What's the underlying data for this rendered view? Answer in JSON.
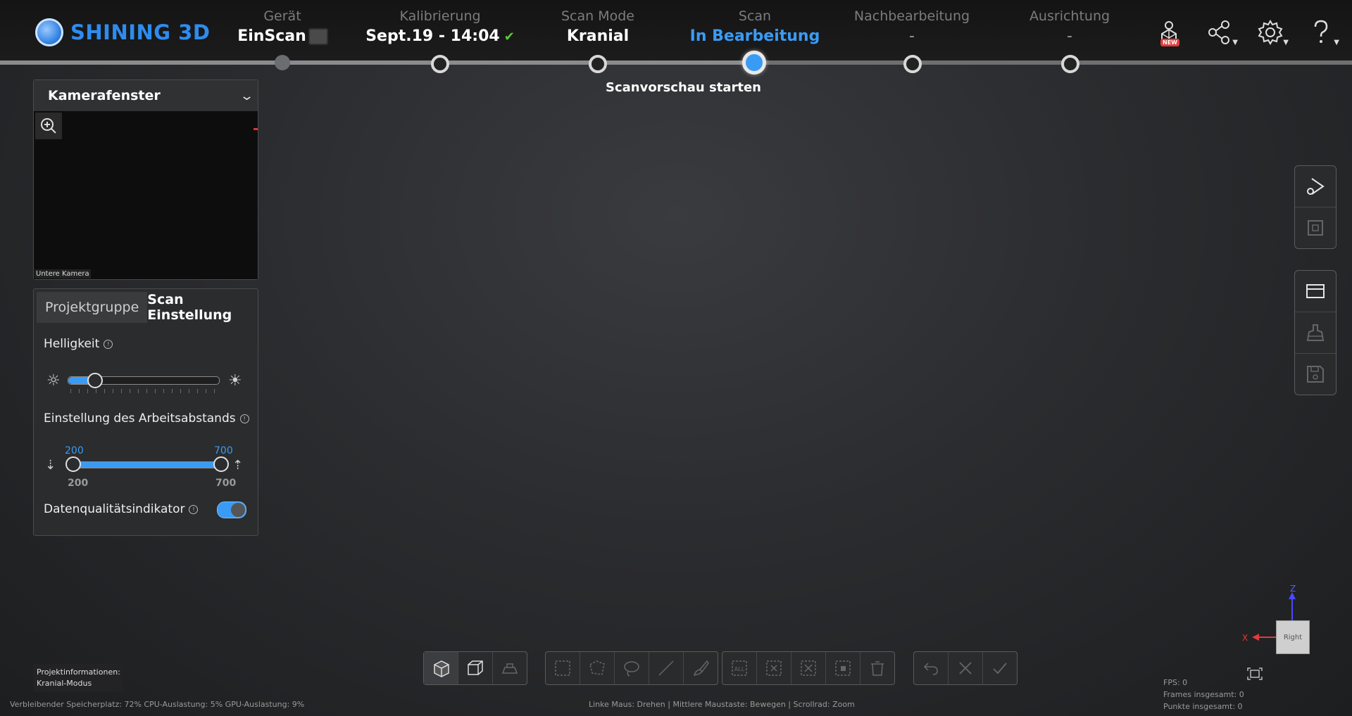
{
  "brand": {
    "name": "SHINING 3D"
  },
  "steps": [
    {
      "label": "Gerät",
      "value": "EinScan"
    },
    {
      "label": "Kalibrierung",
      "value": "Sept.19 - 14:04"
    },
    {
      "label": "Scan Mode",
      "value": "Kranial"
    },
    {
      "label": "Scan",
      "value": "In Bearbeitung"
    },
    {
      "label": "Nachbearbeitung",
      "value": "-"
    },
    {
      "label": "Ausrichtung",
      "value": "-"
    }
  ],
  "step_hint": "Scanvorschau starten",
  "top_icons": {
    "new_badge": "NEW",
    "icons": [
      "model-new-icon",
      "share-icon",
      "gear-icon",
      "help-icon"
    ]
  },
  "camera_panel": {
    "title": "Kamerafenster",
    "camera_label": "Untere Kamera"
  },
  "settings_panel": {
    "tabs": [
      "Projektgruppe",
      "Scan Einstellung"
    ],
    "active_tab": "Scan Einstellung",
    "brightness": {
      "label": "Helligkeit",
      "value": 0.18
    },
    "working_distance": {
      "label": "Einstellung des Arbeitsabstands",
      "min": 200,
      "max": 700,
      "low": 200,
      "high": 700,
      "low_label": "200",
      "high_label": "700"
    },
    "quality_indicator": {
      "label": "Datenqualitätsindikator",
      "enabled": true
    }
  },
  "axis": {
    "z": "Z",
    "x": "X",
    "cube": "Right"
  },
  "project_info": {
    "title": "Projektinformationen:",
    "mode": "Kranial-Modus"
  },
  "status": {
    "left": "Verbleibender Speicherplatz: 72%  CPU-Auslastung: 5%  GPU-Auslastung: 9%",
    "mouse_hint": "Linke Maus: Drehen | Mittlere Maustaste: Bewegen | Scrollrad: Zoom"
  },
  "stats": {
    "fps": "FPS: 0",
    "frames": "Frames insgesamt: 0",
    "points": "Punkte insgesamt: 0"
  },
  "colors": {
    "accent": "#3a9bf5",
    "brand": "#2d8cf0",
    "check": "#5cc83a"
  }
}
